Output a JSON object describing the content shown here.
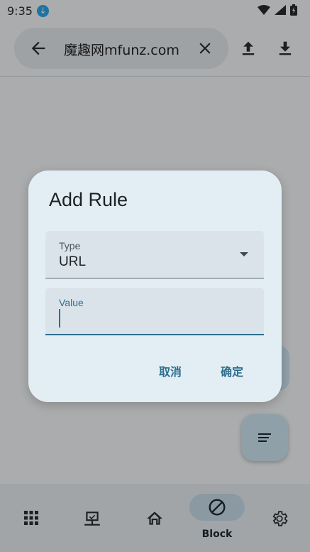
{
  "status_bar": {
    "time": "9:35",
    "download_badge": "↓"
  },
  "toolbar": {
    "search_value": "魔趣网mfunz.com"
  },
  "bottom_nav": {
    "active_label": "Block"
  },
  "dialog": {
    "title": "Add Rule",
    "type_field": {
      "label": "Type",
      "value": "URL"
    },
    "value_field": {
      "label": "Value",
      "value": ""
    },
    "cancel_label": "取消",
    "confirm_label": "确定"
  },
  "colors": {
    "accent": "#2d6e8e",
    "dialog_bg": "#e3eef4",
    "fab_bg": "#cfe6f2",
    "nav_active_pill": "#c8dce8"
  }
}
